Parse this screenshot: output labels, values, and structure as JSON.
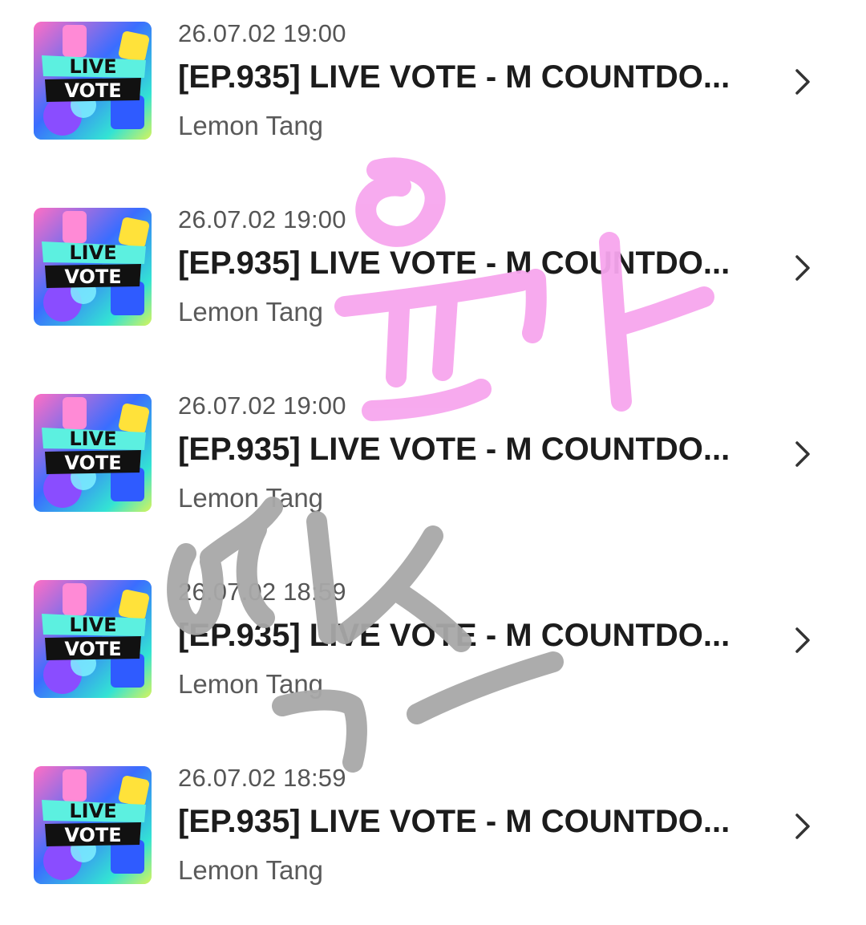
{
  "items": [
    {
      "time": "26.07.02 19:00",
      "title": "[EP.935] LIVE VOTE - M COUNTDO...",
      "author": "Lemon Tang",
      "thumb_text_1": "LIVE",
      "thumb_text_2": "VOTE"
    },
    {
      "time": "26.07.02 19:00",
      "title": "[EP.935] LIVE VOTE - M COUNTDO...",
      "author": "Lemon Tang",
      "thumb_text_1": "LIVE",
      "thumb_text_2": "VOTE"
    },
    {
      "time": "26.07.02 19:00",
      "title": "[EP.935] LIVE VOTE - M COUNTDO...",
      "author": "Lemon Tang",
      "thumb_text_1": "LIVE",
      "thumb_text_2": "VOTE"
    },
    {
      "time": "26.07.02 18:59",
      "title": "[EP.935] LIVE VOTE - M COUNTDO...",
      "author": "Lemon Tang",
      "thumb_text_1": "LIVE",
      "thumb_text_2": "VOTE"
    },
    {
      "time": "26.07.02 18:59",
      "title": "[EP.935] LIVE VOTE - M COUNTDO...",
      "author": "Lemon Tang",
      "thumb_text_1": "LIVE",
      "thumb_text_2": "VOTE"
    }
  ],
  "icons": {
    "chevron": "chevron-right-icon"
  },
  "colors": {
    "title": "#1c1c1c",
    "meta": "#555555",
    "scribble_pink": "#f7a6ee",
    "scribble_gray": "#a8a8a8"
  }
}
